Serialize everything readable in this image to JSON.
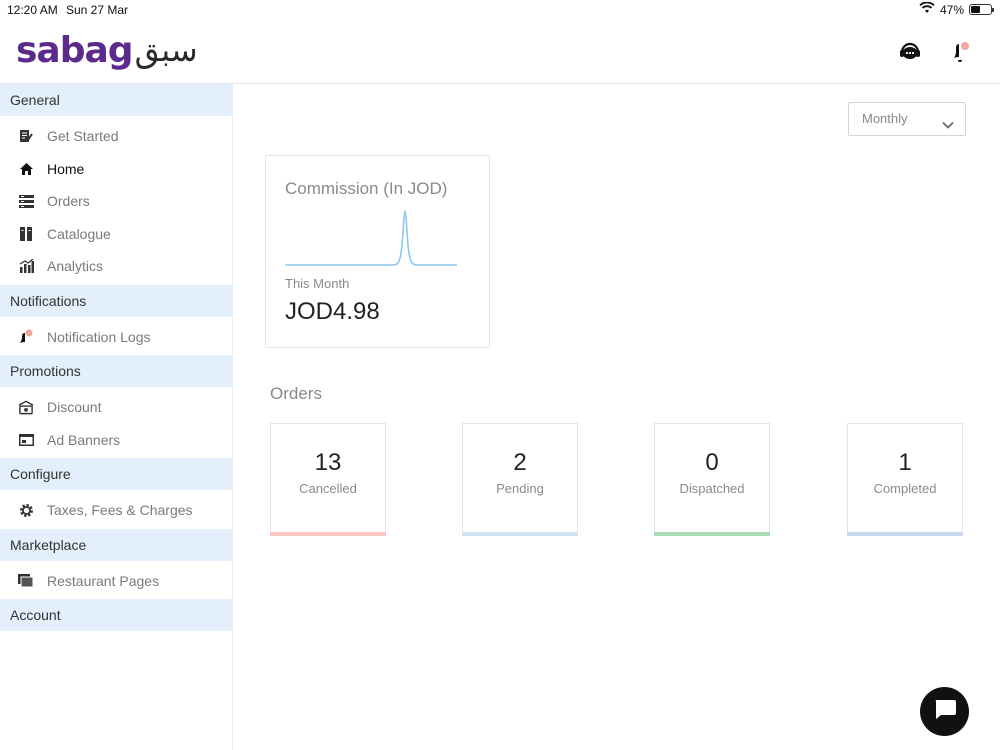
{
  "status_bar": {
    "time": "12:20 AM",
    "date": "Sun 27 Mar",
    "battery": "47%",
    "battery_level": 0.47
  },
  "brand": {
    "latin": "sabag",
    "arabic": "سبق"
  },
  "sidebar": {
    "sections": [
      {
        "title": "General",
        "items": [
          {
            "label": "Get Started",
            "icon": "document-edit-icon"
          },
          {
            "label": "Home",
            "icon": "home-icon",
            "active": true
          },
          {
            "label": "Orders",
            "icon": "orders-list-icon"
          },
          {
            "label": "Catalogue",
            "icon": "catalogue-icon"
          },
          {
            "label": "Analytics",
            "icon": "analytics-icon"
          }
        ]
      },
      {
        "title": "Notifications",
        "items": [
          {
            "label": "Notification Logs",
            "icon": "bell-icon"
          }
        ]
      },
      {
        "title": "Promotions",
        "items": [
          {
            "label": "Discount",
            "icon": "discount-icon"
          },
          {
            "label": "Ad Banners",
            "icon": "ad-banner-icon"
          }
        ]
      },
      {
        "title": "Configure",
        "items": [
          {
            "label": "Taxes, Fees & Charges",
            "icon": "gear-icon"
          }
        ]
      },
      {
        "title": "Marketplace",
        "items": [
          {
            "label": "Restaurant Pages",
            "icon": "pages-icon"
          }
        ]
      },
      {
        "title": "Account",
        "items": []
      }
    ]
  },
  "period_select": {
    "value": "Monthly"
  },
  "commission": {
    "title": "Commission (In JOD)",
    "period_label": "This Month",
    "value": "JOD4.98"
  },
  "orders": {
    "title": "Orders",
    "cards": [
      {
        "count": "13",
        "label": "Cancelled",
        "color": "#f6c6c1"
      },
      {
        "count": "2",
        "label": "Pending",
        "color": "#cfe3f7"
      },
      {
        "count": "0",
        "label": "Dispatched",
        "color": "#a9dcb1"
      },
      {
        "count": "1",
        "label": "Completed",
        "color": "#c9d9f1"
      }
    ]
  },
  "colors": {
    "section_bg": "#e3effb",
    "brand_purple": "#5b2a8c",
    "sparkline": "#8ec9ef"
  }
}
